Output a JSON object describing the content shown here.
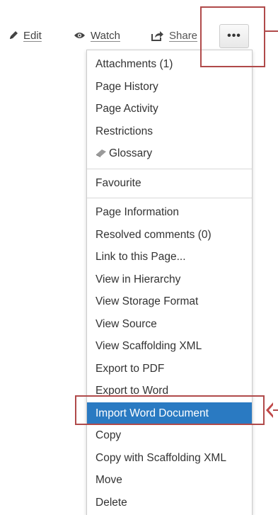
{
  "toolbar": {
    "edit_label": "Edit",
    "watch_label": "Watch",
    "share_label": "Share",
    "more_label": "•••"
  },
  "menu": {
    "sections": [
      [
        "Attachments (1)",
        "Page History",
        "Page Activity",
        "Restrictions",
        "Glossary"
      ],
      [
        "Favourite"
      ],
      [
        "Page Information",
        "Resolved comments (0)",
        "Link to this Page...",
        "View in Hierarchy",
        "View Storage Format",
        "View Source",
        "View Scaffolding XML",
        "Export to PDF",
        "Export to Word",
        "Import Word Document",
        "Copy",
        "Copy with Scaffolding XML",
        "Move",
        "Delete"
      ]
    ],
    "selected_item": "Import Word Document"
  },
  "icons": {
    "edit": "pencil-icon",
    "watch": "eye-icon",
    "share": "share-icon",
    "glossary": "glossary-icon"
  },
  "colors": {
    "selected_bg": "#2a7ac2",
    "highlight_border": "#b04a4a"
  }
}
